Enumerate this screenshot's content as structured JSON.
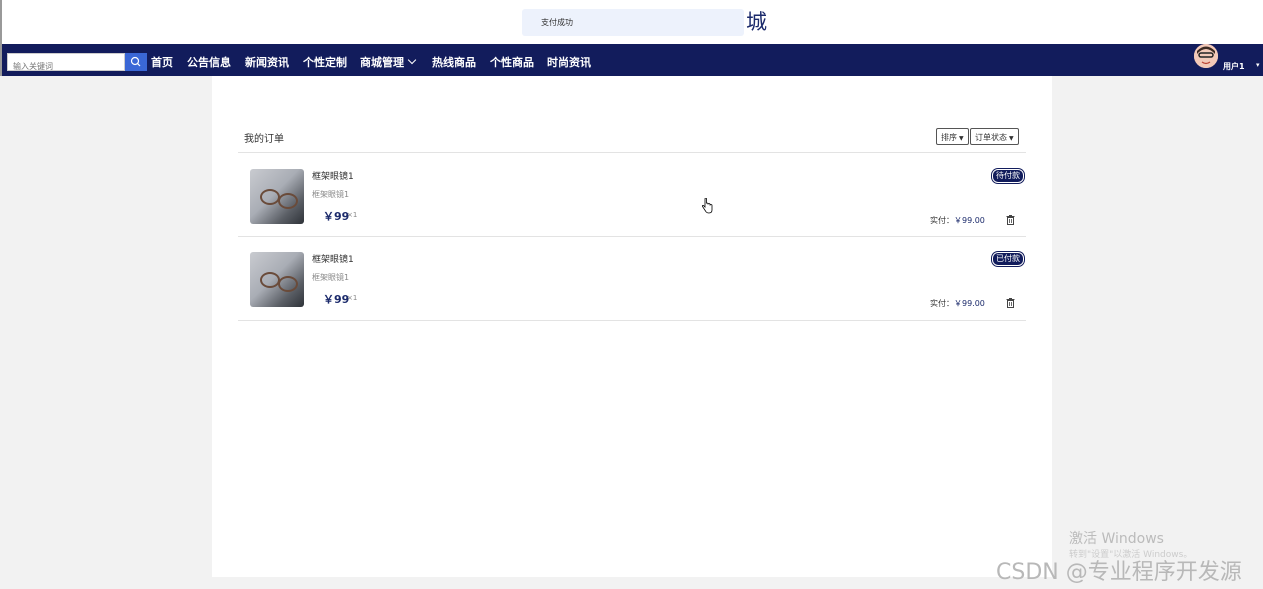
{
  "header": {
    "site_title_fragment": "城",
    "toast": "支付成功"
  },
  "nav": {
    "search_placeholder": "输入关键词",
    "items": [
      {
        "label": "首页",
        "has_dropdown": false
      },
      {
        "label": "公告信息",
        "has_dropdown": false
      },
      {
        "label": "新闻资讯",
        "has_dropdown": false
      },
      {
        "label": "个性定制",
        "has_dropdown": false
      },
      {
        "label": "商城管理",
        "has_dropdown": true
      },
      {
        "label": "热线商品",
        "has_dropdown": false
      },
      {
        "label": "个性商品",
        "has_dropdown": false
      },
      {
        "label": "时尚资讯",
        "has_dropdown": false
      }
    ],
    "username": "用户1",
    "bg_color": "#121c5c",
    "search_button_color": "#3a67d6"
  },
  "orders": {
    "title": "我的订单",
    "sort_label": "排序",
    "status_filter_label": "订单状态",
    "list": [
      {
        "name": "框架眼镜1",
        "desc": "框架眼镜1",
        "price": "￥99",
        "qty": "×1",
        "status": "待付款",
        "paid_label": "实付：",
        "paid_amount": "￥99.00"
      },
      {
        "name": "框架眼镜1",
        "desc": "框架眼镜1",
        "price": "￥99",
        "qty": "×1",
        "status": "已付款",
        "paid_label": "实付：",
        "paid_amount": "￥99.00"
      }
    ]
  },
  "watermarks": {
    "activate_title": "激活 Windows",
    "activate_sub": "转到\"设置\"以激活 Windows。",
    "csdn": "CSDN @专业程序开发源"
  }
}
